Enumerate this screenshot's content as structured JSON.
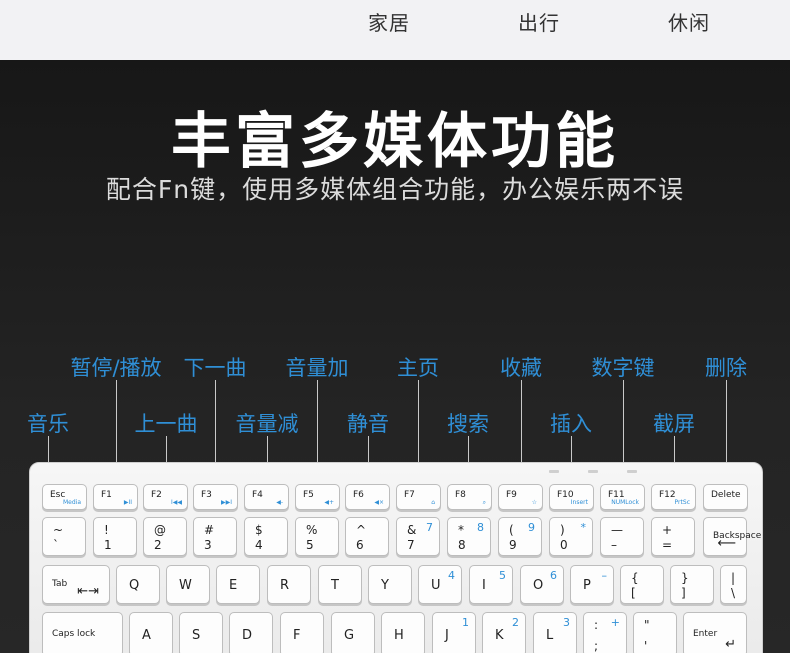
{
  "nav": {
    "items": [
      "家居",
      "出行",
      "休闲"
    ]
  },
  "hero": {
    "title": "丰富多媒体功能",
    "subtitle": "配合Fn键，使用多媒体组合功能，办公娱乐两不误"
  },
  "callouts": [
    {
      "label": "暂停/播放"
    },
    {
      "label": "下一曲"
    },
    {
      "label": "音量加"
    },
    {
      "label": "主页"
    },
    {
      "label": "收藏"
    },
    {
      "label": "数字键"
    },
    {
      "label": "删除"
    },
    {
      "label": "音乐"
    },
    {
      "label": "上一曲"
    },
    {
      "label": "音量减"
    },
    {
      "label": "静音"
    },
    {
      "label": "搜索"
    },
    {
      "label": "插入"
    },
    {
      "label": "截屏"
    }
  ],
  "keyboard": {
    "rows": [
      [
        {
          "main": "Esc",
          "fn": "Media"
        },
        {
          "main": "F1",
          "fn": "▶II"
        },
        {
          "main": "F2",
          "fn": "I◀◀"
        },
        {
          "main": "F3",
          "fn": "▶▶I"
        },
        {
          "main": "F4",
          "fn": "◀-"
        },
        {
          "main": "F5",
          "fn": "◀+"
        },
        {
          "main": "F6",
          "fn": "◀×"
        },
        {
          "main": "F7",
          "fn": "⌂"
        },
        {
          "main": "F8",
          "fn": "⌕"
        },
        {
          "main": "F9",
          "fn": "☆"
        },
        {
          "main": "F10",
          "fn": "Insert"
        },
        {
          "main": "F11",
          "fn": "NUMLock"
        },
        {
          "main": "F12",
          "fn": "PrtSc"
        },
        {
          "main": "Delete"
        }
      ],
      [
        {
          "top": "~",
          "bottom": "`"
        },
        {
          "top": "!",
          "bottom": "1"
        },
        {
          "top": "@",
          "bottom": "2"
        },
        {
          "top": "#",
          "bottom": "3"
        },
        {
          "top": "$",
          "bottom": "4"
        },
        {
          "top": "%",
          "bottom": "5"
        },
        {
          "top": "^",
          "bottom": "6"
        },
        {
          "top": "&",
          "bottom": "7",
          "num": "7"
        },
        {
          "top": "*",
          "bottom": "8",
          "num": "8"
        },
        {
          "top": "(",
          "bottom": "9",
          "num": "9"
        },
        {
          "top": ")",
          "bottom": "0",
          "num": "*"
        },
        {
          "top": "—",
          "bottom": "–"
        },
        {
          "top": "+",
          "bottom": "="
        },
        {
          "main": "Backspace",
          "arrow": "⟵"
        }
      ],
      [
        {
          "main": "Tab",
          "arrow": "⇤⇥"
        },
        {
          "main": "Q"
        },
        {
          "main": "W"
        },
        {
          "main": "E"
        },
        {
          "main": "R"
        },
        {
          "main": "T"
        },
        {
          "main": "Y"
        },
        {
          "main": "U",
          "num": "4"
        },
        {
          "main": "I",
          "num": "5"
        },
        {
          "main": "O",
          "num": "6"
        },
        {
          "main": "P",
          "num": "–"
        },
        {
          "top": "{",
          "bottom": "["
        },
        {
          "top": "}",
          "bottom": "]"
        },
        {
          "top": "|",
          "bottom": "\\"
        }
      ],
      [
        {
          "main": "Caps lock"
        },
        {
          "main": "A"
        },
        {
          "main": "S"
        },
        {
          "main": "D"
        },
        {
          "main": "F"
        },
        {
          "main": "G"
        },
        {
          "main": "H"
        },
        {
          "main": "J",
          "num": "1"
        },
        {
          "main": "K",
          "num": "2"
        },
        {
          "main": "L",
          "num": "3"
        },
        {
          "top": ":",
          "bottom": ";",
          "num": "+"
        },
        {
          "top": "\"",
          "bottom": "'"
        },
        {
          "main": "Enter",
          "arrow": "↵"
        }
      ]
    ]
  },
  "colors": {
    "accent": "#2f8fd6",
    "background": "#1c1c1c",
    "nav": "#f2f2f4"
  }
}
